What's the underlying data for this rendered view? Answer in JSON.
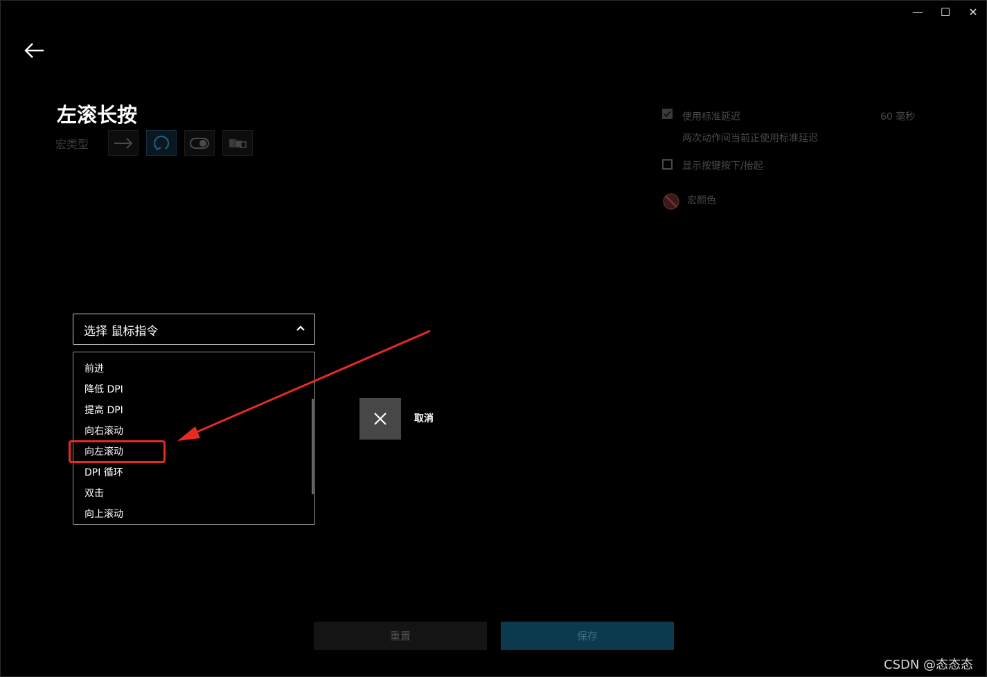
{
  "window": {
    "controls": {
      "minimize": "—",
      "maximize": "☐",
      "close": "✕"
    }
  },
  "header": {
    "title": "左滚长按",
    "macro_type_label": "宏类型",
    "macro_types": [
      {
        "icon": "arrow-right-icon"
      },
      {
        "icon": "repeat-icon",
        "active": true
      },
      {
        "icon": "toggle-icon"
      },
      {
        "icon": "sequence-icon"
      }
    ]
  },
  "options": {
    "standard_delay_label": "使用标准延迟",
    "standard_delay_value": "60 毫秒",
    "standard_delay_desc": "两次动作间当前正使用标准延迟",
    "standard_delay_checked": true,
    "show_key_label": "显示按键按下/抬起",
    "show_key_checked": false,
    "macro_color_label": "宏颜色"
  },
  "dropdown": {
    "label": "选择 鼠标指令",
    "items": [
      "前进",
      "降低 DPI",
      "提高 DPI",
      "向右滚动",
      "向左滚动",
      "DPI 循环",
      "双击",
      "向上滚动"
    ],
    "highlighted_index": 4
  },
  "cancel": {
    "label": "取消"
  },
  "footer": {
    "reset_label": "重置",
    "save_label": "保存"
  },
  "watermark": "CSDN @态态态",
  "colors": {
    "annotation": "#e52b22",
    "save_bg": "#0b3a4f"
  }
}
